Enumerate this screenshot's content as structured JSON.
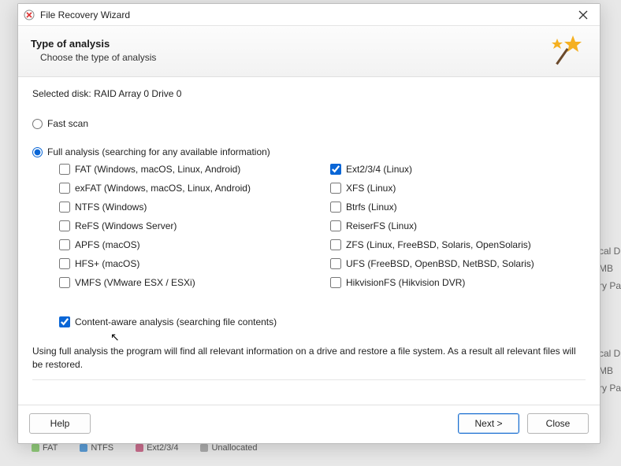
{
  "window": {
    "title": "File Recovery Wizard"
  },
  "header": {
    "title": "Type of analysis",
    "subtitle": "Choose the type of analysis"
  },
  "selected_disk_label": "Selected disk:",
  "selected_disk_value": "RAID Array 0 Drive 0",
  "options": {
    "fast_scan": "Fast scan",
    "full_analysis": "Full analysis (searching for any available information)"
  },
  "selected_option": "full_analysis",
  "filesystems_left": [
    {
      "id": "fat",
      "label": "FAT (Windows, macOS, Linux, Android)",
      "checked": false
    },
    {
      "id": "exfat",
      "label": "exFAT (Windows, macOS, Linux, Android)",
      "checked": false
    },
    {
      "id": "ntfs",
      "label": "NTFS (Windows)",
      "checked": false
    },
    {
      "id": "refs",
      "label": "ReFS (Windows Server)",
      "checked": false
    },
    {
      "id": "apfs",
      "label": "APFS (macOS)",
      "checked": false
    },
    {
      "id": "hfs",
      "label": "HFS+ (macOS)",
      "checked": false
    },
    {
      "id": "vmfs",
      "label": "VMFS (VMware ESX / ESXi)",
      "checked": false
    }
  ],
  "filesystems_right": [
    {
      "id": "ext",
      "label": "Ext2/3/4 (Linux)",
      "checked": true
    },
    {
      "id": "xfs",
      "label": "XFS (Linux)",
      "checked": false
    },
    {
      "id": "btrfs",
      "label": "Btrfs (Linux)",
      "checked": false
    },
    {
      "id": "reiserfs",
      "label": "ReiserFS (Linux)",
      "checked": false
    },
    {
      "id": "zfs",
      "label": "ZFS (Linux, FreeBSD, Solaris, OpenSolaris)",
      "checked": false
    },
    {
      "id": "ufs",
      "label": "UFS (FreeBSD, OpenBSD, NetBSD, Solaris)",
      "checked": false
    },
    {
      "id": "hikfs",
      "label": "HikvisionFS (Hikvision DVR)",
      "checked": false
    }
  ],
  "content_aware": {
    "label": "Content-aware analysis (searching file contents)",
    "checked": true
  },
  "description": "Using full analysis the program will find all relevant information on a drive and restore a file system. As a result all relevant files will be restored.",
  "buttons": {
    "help": "Help",
    "next": "Next >",
    "close": "Close"
  },
  "background": {
    "panel1_title": "cal D",
    "panel1_line1": "MB",
    "panel1_line2": "ry Pa",
    "panel2_title": "cal D",
    "panel2_line1": "MB",
    "panel2_line2": "ry Pa",
    "legend": {
      "fat": "FAT",
      "ntfs": "NTFS",
      "ext": "Ext2/3/4",
      "unallocated": "Unallocated"
    }
  }
}
